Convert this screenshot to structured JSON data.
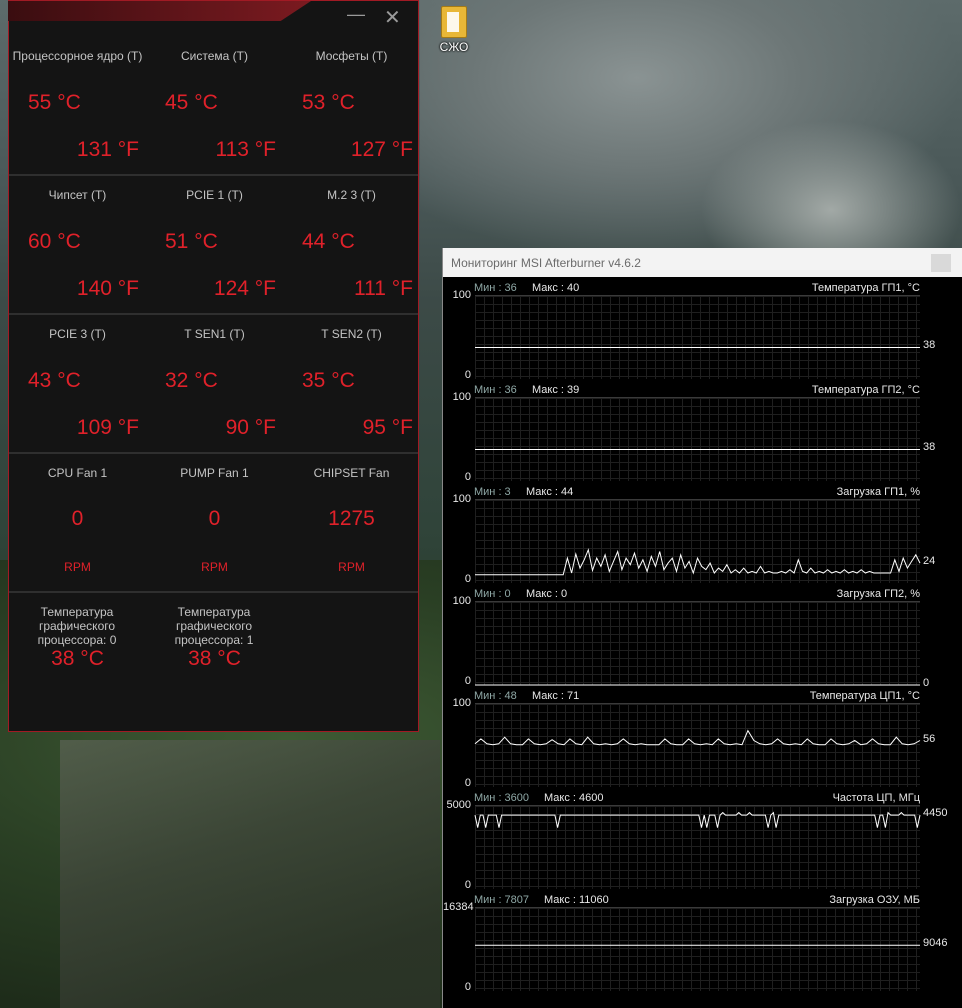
{
  "desktop": {
    "icon_label": "СЖО"
  },
  "asus": {
    "rows": [
      [
        {
          "name": "Процессорное ядро (T)",
          "c": "55 °C",
          "f": "131 °F"
        },
        {
          "name": "Система (T)",
          "c": "45 °C",
          "f": "113 °F"
        },
        {
          "name": "Мосфеты (T)",
          "c": "53 °C",
          "f": "127 °F"
        }
      ],
      [
        {
          "name": "Чипсет (T)",
          "c": "60 °C",
          "f": "140 °F"
        },
        {
          "name": "PCIE 1 (T)",
          "c": "51 °C",
          "f": "124 °F"
        },
        {
          "name": "M.2 3 (T)",
          "c": "44 °C",
          "f": "111 °F"
        }
      ],
      [
        {
          "name": "PCIE 3 (T)",
          "c": "43 °C",
          "f": "109 °F"
        },
        {
          "name": "T SEN1 (T)",
          "c": "32 °C",
          "f": "90 °F"
        },
        {
          "name": "T SEN2 (T)",
          "c": "35 °C",
          "f": "95 °F"
        }
      ]
    ],
    "fans": [
      {
        "name": "CPU Fan 1",
        "value": "0",
        "unit": "RPM"
      },
      {
        "name": "PUMP Fan 1",
        "value": "0",
        "unit": "RPM"
      },
      {
        "name": "CHIPSET Fan",
        "value": "1275",
        "unit": "RPM"
      }
    ],
    "gpu": [
      {
        "name": "Температура графического процессора: 0",
        "value": "38 °C"
      },
      {
        "name": "Температура графического процессора: 1",
        "value": "38 °C"
      }
    ]
  },
  "afterburner": {
    "title": "Мониторинг MSI Afterburner v4.6.2",
    "graphs": [
      {
        "min_label": "Мин : 36",
        "max_label": "Макс : 40",
        "name": "Температура ГП1, °C",
        "top": "100",
        "bottom": "0",
        "current": "38",
        "scale_max": 100,
        "series": [
          38,
          38,
          38,
          38,
          38,
          38,
          38,
          38,
          38,
          38,
          38,
          38,
          38,
          38,
          38,
          38,
          38,
          38,
          38,
          38,
          38,
          38,
          38,
          38,
          38,
          38,
          38,
          38,
          38,
          38,
          38,
          38,
          38,
          38,
          38,
          38,
          38,
          38,
          38,
          38
        ]
      },
      {
        "min_label": "Мин : 36",
        "max_label": "Макс : 39",
        "name": "Температура ГП2, °C",
        "top": "100",
        "bottom": "0",
        "current": "38",
        "scale_max": 100,
        "series": [
          38,
          38,
          38,
          38,
          38,
          38,
          38,
          38,
          38,
          38,
          38,
          38,
          38,
          38,
          38,
          38,
          38,
          38,
          38,
          38,
          38,
          38,
          38,
          38,
          38,
          38,
          38,
          38,
          38,
          38,
          38,
          38,
          38,
          38,
          38,
          38,
          38,
          38,
          38,
          38
        ]
      },
      {
        "min_label": "Мин : 3",
        "max_label": "Макс : 44",
        "name": "Загрузка ГП1, %",
        "top": "100",
        "bottom": "0",
        "current": "24",
        "scale_max": 100,
        "series": [
          10,
          10,
          10,
          10,
          10,
          10,
          10,
          10,
          10,
          10,
          10,
          10,
          10,
          10,
          10,
          10,
          10,
          10,
          10,
          10,
          10,
          10,
          30,
          12,
          35,
          18,
          28,
          40,
          15,
          30,
          20,
          34,
          14,
          26,
          38,
          16,
          30,
          22,
          36,
          18,
          28,
          14,
          32,
          20,
          38,
          16,
          24,
          30,
          14,
          34,
          18,
          26,
          12,
          30,
          20,
          16,
          24,
          12,
          18,
          14,
          22,
          12,
          16,
          12,
          18,
          12,
          14,
          12,
          20,
          12,
          14,
          12,
          12,
          14,
          12,
          16,
          12,
          28,
          14,
          12,
          18,
          12,
          14,
          12,
          16,
          12,
          14,
          12,
          16,
          12,
          14,
          12,
          16,
          12,
          14,
          12,
          12,
          12,
          12,
          12,
          28,
          14,
          30,
          18,
          26,
          34,
          24
        ]
      },
      {
        "min_label": "Мин : 0",
        "max_label": "Макс : 0",
        "name": "Загрузка ГП2, %",
        "top": "100",
        "bottom": "0",
        "current": "0",
        "scale_max": 100,
        "series": [
          0,
          0,
          0,
          0,
          0,
          0,
          0,
          0,
          0,
          0,
          0,
          0,
          0,
          0,
          0,
          0,
          0,
          0,
          0,
          0
        ]
      },
      {
        "min_label": "Мин : 48",
        "max_label": "Макс : 71",
        "name": "Температура ЦП1, °C",
        "top": "100",
        "bottom": "0",
        "current": "56",
        "scale_max": 100,
        "series": [
          52,
          58,
          52,
          51,
          52,
          60,
          52,
          51,
          51,
          58,
          52,
          51,
          52,
          57,
          52,
          51,
          58,
          52,
          51,
          60,
          52,
          51,
          52,
          51,
          52,
          58,
          52,
          51,
          52,
          51,
          51,
          51,
          58,
          52,
          51,
          51,
          58,
          52,
          51,
          52,
          51,
          58,
          52,
          51,
          52,
          51,
          68,
          56,
          52,
          51,
          52,
          58,
          52,
          51,
          52,
          51,
          58,
          52,
          51,
          51,
          58,
          52,
          51,
          52,
          56,
          51,
          52,
          58,
          52,
          51,
          51,
          60,
          52,
          51,
          52,
          56
        ]
      },
      {
        "min_label": "Мин : 3600",
        "max_label": "Макс : 4600",
        "name": "Частота ЦП, МГц",
        "top": "5000",
        "bottom": "0",
        "current": "4450",
        "scale_max": 5000,
        "series": [
          4450,
          3700,
          4450,
          4450,
          3700,
          4450,
          4450,
          4450,
          4450,
          3700,
          4450,
          4450,
          4450,
          4450,
          4450,
          4450,
          4450,
          4450,
          4450,
          4450,
          4450,
          4450,
          4450,
          4450,
          4450,
          4450,
          4450,
          4450,
          4450,
          4450,
          4450,
          3700,
          4450,
          4450,
          4450,
          4450,
          4450,
          4450,
          4450,
          4450,
          4450,
          4450,
          4450,
          4450,
          4450,
          4450,
          4450,
          4450,
          4450,
          4450,
          4450,
          4450,
          4450,
          4450,
          4450,
          4450,
          4450,
          4450,
          4450,
          4450,
          4450,
          4450,
          4450,
          4450,
          4450,
          4450,
          4450,
          4450,
          4450,
          4450,
          4450,
          4450,
          4450,
          4450,
          4450,
          4450,
          4450,
          4450,
          4450,
          4450,
          4450,
          4450,
          4450,
          4450,
          4450,
          3700,
          4450,
          3700,
          4450,
          4450,
          4450,
          3700,
          4450,
          4600,
          4450,
          4450,
          4450,
          4450,
          4450,
          4600,
          4450,
          4450,
          4450,
          4600,
          4450,
          4450,
          4450,
          4450,
          4450,
          4450,
          3700,
          4450,
          4600,
          3700,
          4450,
          4450,
          4450,
          4450,
          4450,
          4450,
          4450,
          4450,
          4450,
          4450,
          4450,
          4450,
          4450,
          4450,
          4450,
          4450,
          4450,
          4450,
          4450,
          4450,
          4450,
          4450,
          4450,
          4450,
          4450,
          4450,
          4450,
          4450,
          4450,
          4450,
          4450,
          4450,
          4450,
          4450,
          4450,
          4450,
          4450,
          3700,
          4450,
          4450,
          3700,
          4600,
          4450,
          4450,
          4450,
          4450,
          4600,
          4450,
          4450,
          4450,
          4450,
          4450,
          3700,
          4450
        ]
      },
      {
        "min_label": "Мин : 7807",
        "max_label": "Макс : 11060",
        "name": "Загрузка ОЗУ, МБ",
        "top": "16384",
        "bottom": "0",
        "current": "9046",
        "scale_max": 16384,
        "series": [
          9046,
          9046,
          9046,
          9046,
          9046,
          9046,
          9046,
          9046,
          9046,
          9046,
          9046,
          9046,
          9046,
          9046,
          9046,
          9046,
          9046,
          9046,
          9046,
          9046
        ]
      }
    ]
  }
}
